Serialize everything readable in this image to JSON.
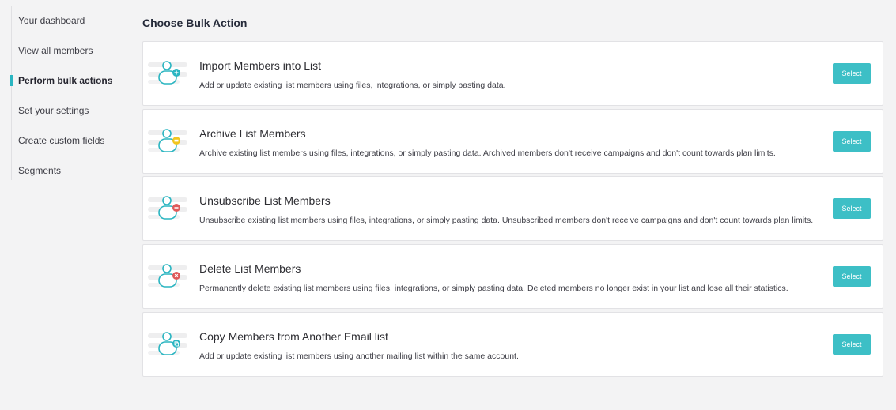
{
  "sidebar": {
    "items": [
      {
        "label": "Your dashboard"
      },
      {
        "label": "View all members"
      },
      {
        "label": "Perform bulk actions"
      },
      {
        "label": "Set your settings"
      },
      {
        "label": "Create custom fields"
      },
      {
        "label": "Segments"
      }
    ],
    "active_index": 2
  },
  "main": {
    "title": "Choose Bulk Action",
    "cards": [
      {
        "title": "Import Members into List",
        "description": "Add or update existing list members using files, integrations, or simply pasting data.",
        "button": "Select",
        "badge_icon": "plus-badge-icon",
        "badge_color": "#2ab5c1"
      },
      {
        "title": "Archive List Members",
        "description": "Archive existing list members using files, integrations, or simply pasting data. Archived members don't receive campaigns and don't count towards plan limits.",
        "button": "Select",
        "badge_icon": "archive-badge-icon",
        "badge_color": "#f2c51d"
      },
      {
        "title": "Unsubscribe List Members",
        "description": "Unsubscribe existing list members using files, integrations, or simply pasting data. Unsubscribed members don't receive campaigns and don't count towards plan limits.",
        "button": "Select",
        "badge_icon": "minus-badge-icon",
        "badge_color": "#e05a5a"
      },
      {
        "title": "Delete List Members",
        "description": "Permanently delete existing list members using files, integrations, or simply pasting data. Deleted members no longer exist in your list and lose all their statistics.",
        "button": "Select",
        "badge_icon": "x-badge-icon",
        "badge_color": "#e05a5a"
      },
      {
        "title": "Copy Members from Another Email list",
        "description": "Add or update existing list members using another mailing list within the same account.",
        "button": "Select",
        "badge_icon": "copy-badge-icon",
        "badge_color": "#2ab5c1"
      }
    ]
  },
  "colors": {
    "accent": "#3dbfc6",
    "background": "#f3f3f4"
  }
}
